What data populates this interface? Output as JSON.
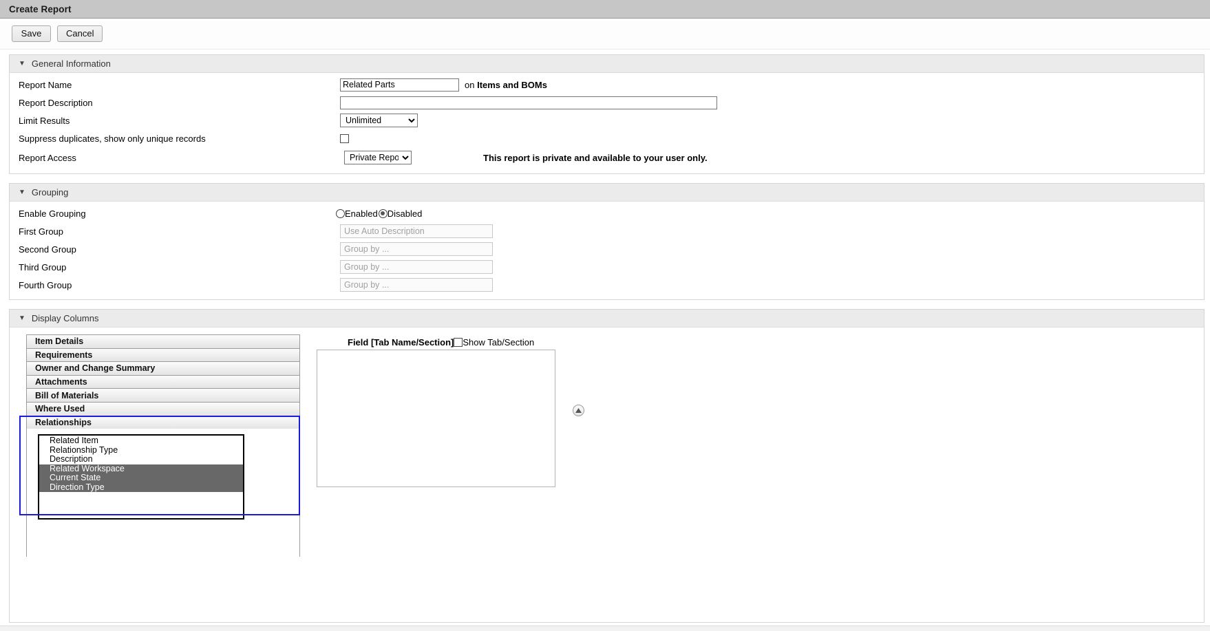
{
  "window": {
    "title": "Create Report"
  },
  "toolbar": {
    "save_label": "Save",
    "cancel_label": "Cancel"
  },
  "sections": {
    "general": {
      "title": "General Information",
      "twisty": "▼",
      "report_name": {
        "label": "Report Name",
        "value": "Related Parts",
        "suffix_prefix": "on ",
        "suffix_bold": "Items and BOMs"
      },
      "report_description": {
        "label": "Report Description",
        "value": "",
        "placeholder": ""
      },
      "limit_results": {
        "label": "Limit Results",
        "selected": "Unlimited",
        "options": [
          "Unlimited"
        ]
      },
      "suppress_duplicates": {
        "label": "Suppress duplicates, show only unique records",
        "checked": false
      },
      "report_access": {
        "label": "Report Access",
        "selected": "Private Report",
        "options": [
          "Private Report"
        ],
        "note": "This report is private and available to your user only."
      }
    },
    "grouping": {
      "title": "Grouping",
      "twisty": "▼",
      "enable_grouping": {
        "label": "Enable Grouping",
        "enabled_label": "Enabled",
        "disabled_label": "Disabled",
        "selected": "Disabled"
      },
      "groups": [
        {
          "label": "First Group",
          "value": "Use Auto Description",
          "disabled": true
        },
        {
          "label": "Second Group",
          "value": "Group by ...",
          "disabled": true
        },
        {
          "label": "Third Group",
          "value": "Group by ...",
          "disabled": true
        },
        {
          "label": "Fourth Group",
          "value": "Group by ...",
          "disabled": true
        }
      ]
    },
    "display_columns": {
      "title": "Display Columns",
      "twisty": "▼",
      "accordion": [
        {
          "label": "Item Details",
          "expanded": false
        },
        {
          "label": "Requirements",
          "expanded": false
        },
        {
          "label": "Owner and Change Summary",
          "expanded": false
        },
        {
          "label": "Attachments",
          "expanded": false
        },
        {
          "label": "Bill of Materials",
          "expanded": false
        },
        {
          "label": "Where Used",
          "expanded": false
        },
        {
          "label": "Relationships",
          "expanded": true
        }
      ],
      "available_fields": [
        {
          "label": "Related Item",
          "selected": false
        },
        {
          "label": "Relationship Type",
          "selected": false
        },
        {
          "label": "Description",
          "selected": false
        },
        {
          "label": "Related Workspace",
          "selected": true
        },
        {
          "label": "Current State",
          "selected": true
        },
        {
          "label": "Direction Type",
          "selected": true
        }
      ],
      "selected_panel": {
        "header_label": "Field [Tab Name/Section]",
        "show_tab_label": "Show Tab/Section",
        "show_tab_checked": false,
        "move_up_icon": "triangle-up-icon"
      }
    }
  },
  "colors": {
    "titlebar": "#c6c6c6",
    "panel_header": "#ebebeb",
    "focus_outline": "#1a1ae0",
    "list_selection": "#686868"
  }
}
